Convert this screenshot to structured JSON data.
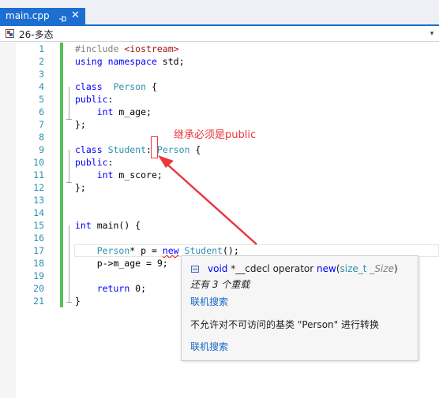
{
  "tab": {
    "title": "main.cpp",
    "pin_icon": "pin-icon",
    "close_label": "✕",
    "color": "#1c6fd0"
  },
  "navbar": {
    "value": "26-多态",
    "dropdown_glyph": "▾"
  },
  "editor": {
    "lines": [
      {
        "n": "1",
        "html": "<span class=\"pp\">#include </span><span class=\"str\">&lt;iostream&gt;</span>"
      },
      {
        "n": "2",
        "html": "<span class=\"kw\">using</span> <span class=\"kw\">namespace</span> std;"
      },
      {
        "n": "3",
        "html": ""
      },
      {
        "n": "4",
        "html": "<span class=\"kw\">class</span>  <span class=\"ty\">Person</span> {"
      },
      {
        "n": "5",
        "html": "<span class=\"kw\">public</span>:"
      },
      {
        "n": "6",
        "html": "    <span class=\"kw\">int</span> m_age;"
      },
      {
        "n": "7",
        "html": "};"
      },
      {
        "n": "8",
        "html": ""
      },
      {
        "n": "9",
        "html": "<span class=\"kw\">class</span> <span class=\"ty\">Student</span>: <span class=\"ty\">Person</span> {"
      },
      {
        "n": "10",
        "html": "<span class=\"kw\">public</span>:"
      },
      {
        "n": "11",
        "html": "    <span class=\"kw\">int</span> m_score;"
      },
      {
        "n": "12",
        "html": "};"
      },
      {
        "n": "13",
        "html": ""
      },
      {
        "n": "14",
        "html": ""
      },
      {
        "n": "15",
        "html": "<span class=\"kw\">int</span> main() {"
      },
      {
        "n": "16",
        "html": ""
      },
      {
        "n": "17",
        "html": "    <span class=\"ty\">Person</span>* p = <span class=\"kw squig\">new</span> <span class=\"ty\">Student</span>();"
      },
      {
        "n": "18",
        "html": "    p-&gt;m_age = 9;"
      },
      {
        "n": "19",
        "html": ""
      },
      {
        "n": "20",
        "html": "    <span class=\"kw\">return</span> 0;"
      },
      {
        "n": "21",
        "html": "}"
      }
    ]
  },
  "annotation": {
    "text": "继承必须是public",
    "color": "#e8383d"
  },
  "tooltip": {
    "icon": "method-icon",
    "sig_kw": "void",
    "sig_name": "*__cdecl operator",
    "sig_new": "new",
    "sig_paren_open": "(",
    "sig_type": "size_t",
    "sig_param": " _Size",
    "sig_paren_close": ")",
    "overloads": "还有 3 个重载",
    "link1": "联机搜索",
    "error": "不允许对不可访问的基类 \"Person\" 进行转换",
    "link2": "联机搜索"
  }
}
